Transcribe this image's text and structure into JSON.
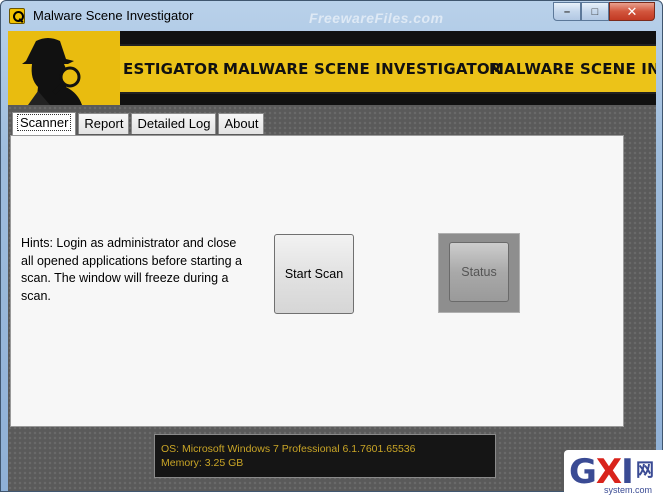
{
  "window": {
    "title": "Malware Scene Investigator",
    "watermark": "FreewareFiles.com",
    "buttons": {
      "minimize": "–",
      "maximize": "□",
      "close": "✕"
    }
  },
  "banner": {
    "segments": [
      "ESTIGATOR",
      "MALWARE SCENE INVESTIGATOR",
      "MALWARE SCENE INV"
    ],
    "colors": {
      "yellow": "#ecc318",
      "dark": "#111111"
    }
  },
  "tabs": [
    {
      "label": "Scanner",
      "active": true
    },
    {
      "label": "Report",
      "active": false
    },
    {
      "label": "Detailed Log",
      "active": false
    },
    {
      "label": "About",
      "active": false
    }
  ],
  "scanner": {
    "hints": "Hints: Login as administrator and close all opened applications before starting a scan. The window will freeze during a scan.",
    "start_scan_label": "Start Scan",
    "status_label": "Status"
  },
  "sysinfo": {
    "os_line": "OS: Microsoft Windows 7 Professional  6.1.7601.65536",
    "memory_line": "Memory: 3.25 GB",
    "text_color": "#c9a526"
  },
  "corner_logo": {
    "brand_g": "G",
    "brand_x": "X",
    "brand_i": "I",
    "brand_cn": "网",
    "brand_sub": "system.com"
  }
}
